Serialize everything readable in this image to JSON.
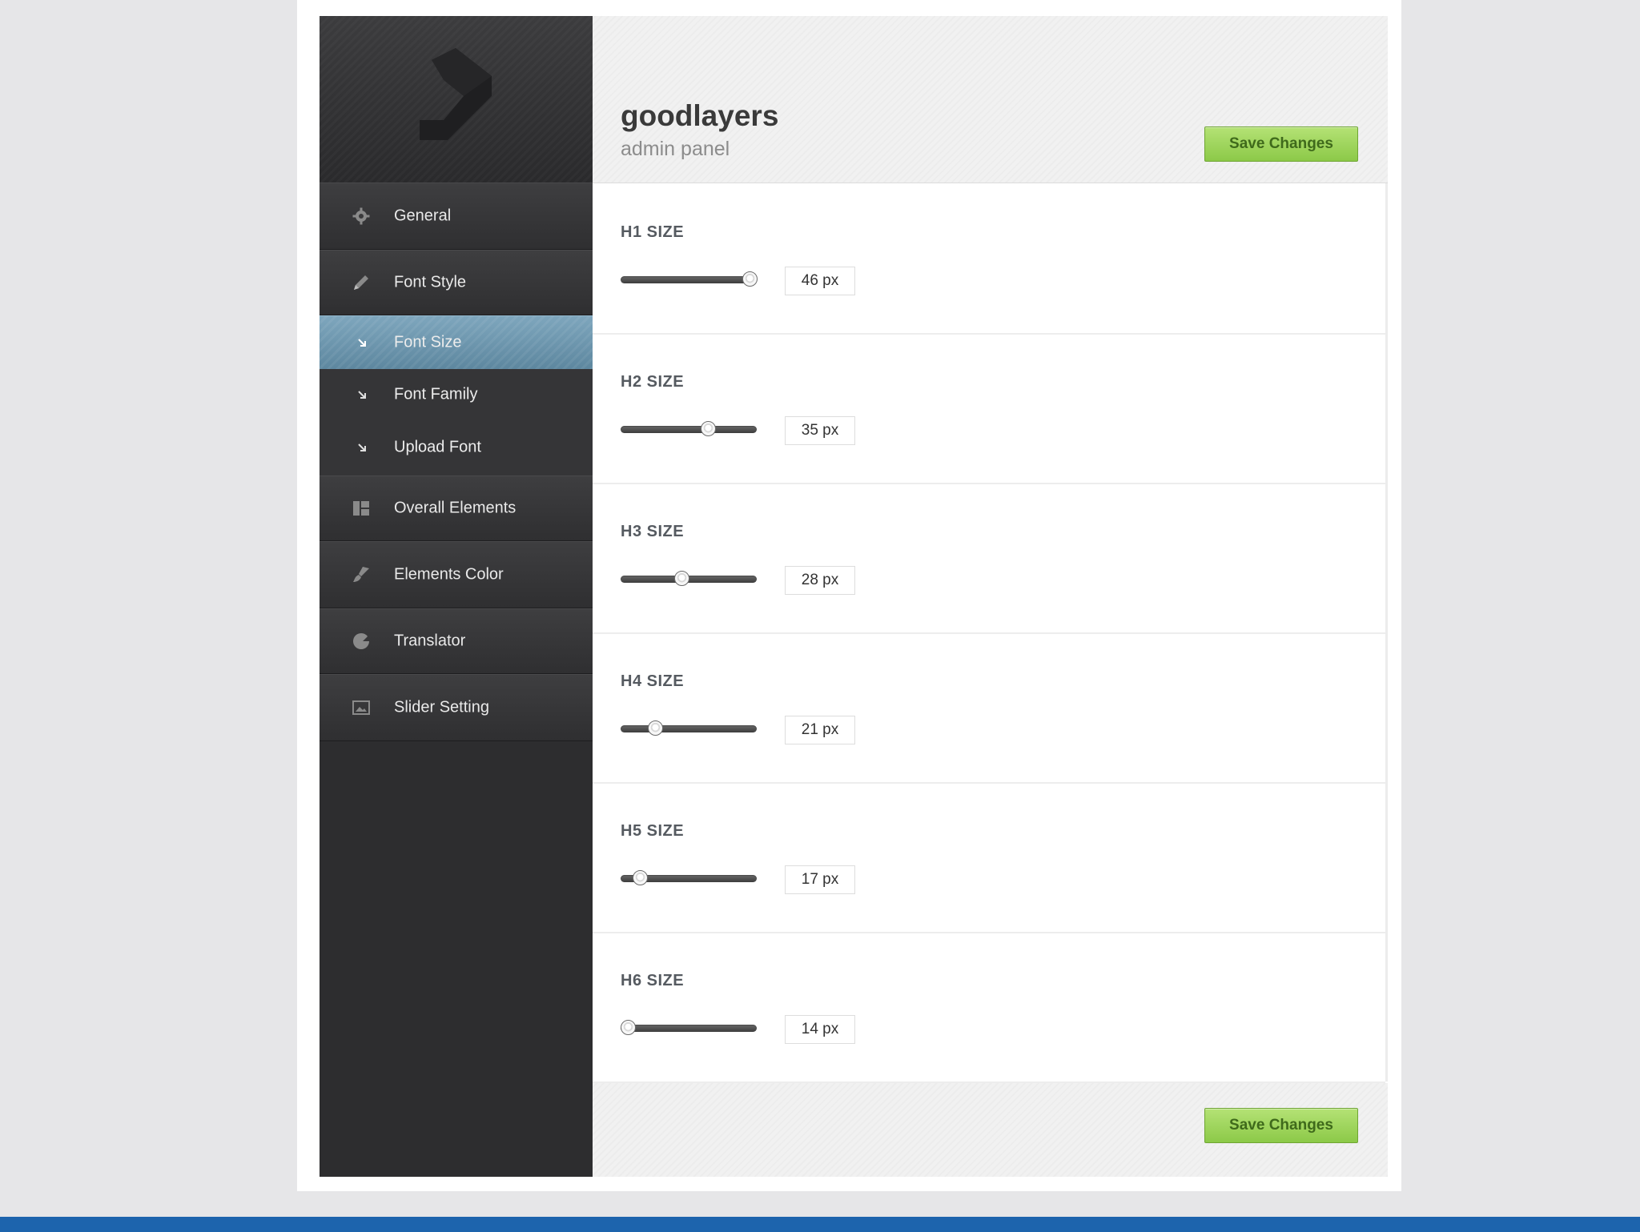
{
  "header": {
    "title": "goodlayers",
    "subtitle": "admin panel",
    "save_label": "Save Changes"
  },
  "footer": {
    "save_label": "Save Changes"
  },
  "sidebar": {
    "items": [
      {
        "label": "General",
        "icon": "gear-icon"
      },
      {
        "label": "Font Style",
        "icon": "pencil-icon"
      },
      {
        "label": "Overall Elements",
        "icon": "layout-icon"
      },
      {
        "label": "Elements Color",
        "icon": "brush-icon"
      },
      {
        "label": "Translator",
        "icon": "translator-icon"
      },
      {
        "label": "Slider Setting",
        "icon": "image-icon"
      }
    ],
    "sub_items": [
      {
        "label": "Font Size",
        "active": true
      },
      {
        "label": "Font Family",
        "active": false
      },
      {
        "label": "Upload Font",
        "active": false
      }
    ]
  },
  "settings": [
    {
      "label": "H1 SIZE",
      "value_text": "46 px",
      "value": 46
    },
    {
      "label": "H2 SIZE",
      "value_text": "35 px",
      "value": 35
    },
    {
      "label": "H3 SIZE",
      "value_text": "28 px",
      "value": 28
    },
    {
      "label": "H4 SIZE",
      "value_text": "21 px",
      "value": 21
    },
    {
      "label": "H5 SIZE",
      "value_text": "17 px",
      "value": 17
    },
    {
      "label": "H6 SIZE",
      "value_text": "14 px",
      "value": 14
    }
  ],
  "slider_range": {
    "min": 12,
    "max": 48
  },
  "colors": {
    "accent_green": "#9bd35a",
    "active_nav": "#6f98b0",
    "sidebar_bg": "#2d2d2f",
    "bottom_bar": "#1d64ad"
  }
}
